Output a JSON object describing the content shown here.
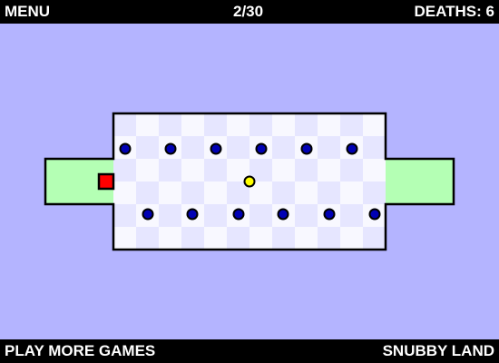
{
  "topbar": {
    "menu_label": "MENU",
    "level_progress": "2/30",
    "deaths_label": "DEATHS: 6"
  },
  "bottombar": {
    "play_more_label": "PLAY MORE GAMES",
    "brand_label": "SNUBBY LAND"
  },
  "colors": {
    "background": "#b4b4ff",
    "safe_zone": "#b4ffb4",
    "tile_light": "#f8f8ff",
    "tile_dark": "#e6e6ff",
    "player": "#ff0000",
    "enemy": "#0000b4",
    "coin": "#ffff00"
  },
  "game": {
    "player": "red-square",
    "enemies_top_row_count": 6,
    "enemies_bottom_row_count": 6,
    "coins_count": 1
  }
}
